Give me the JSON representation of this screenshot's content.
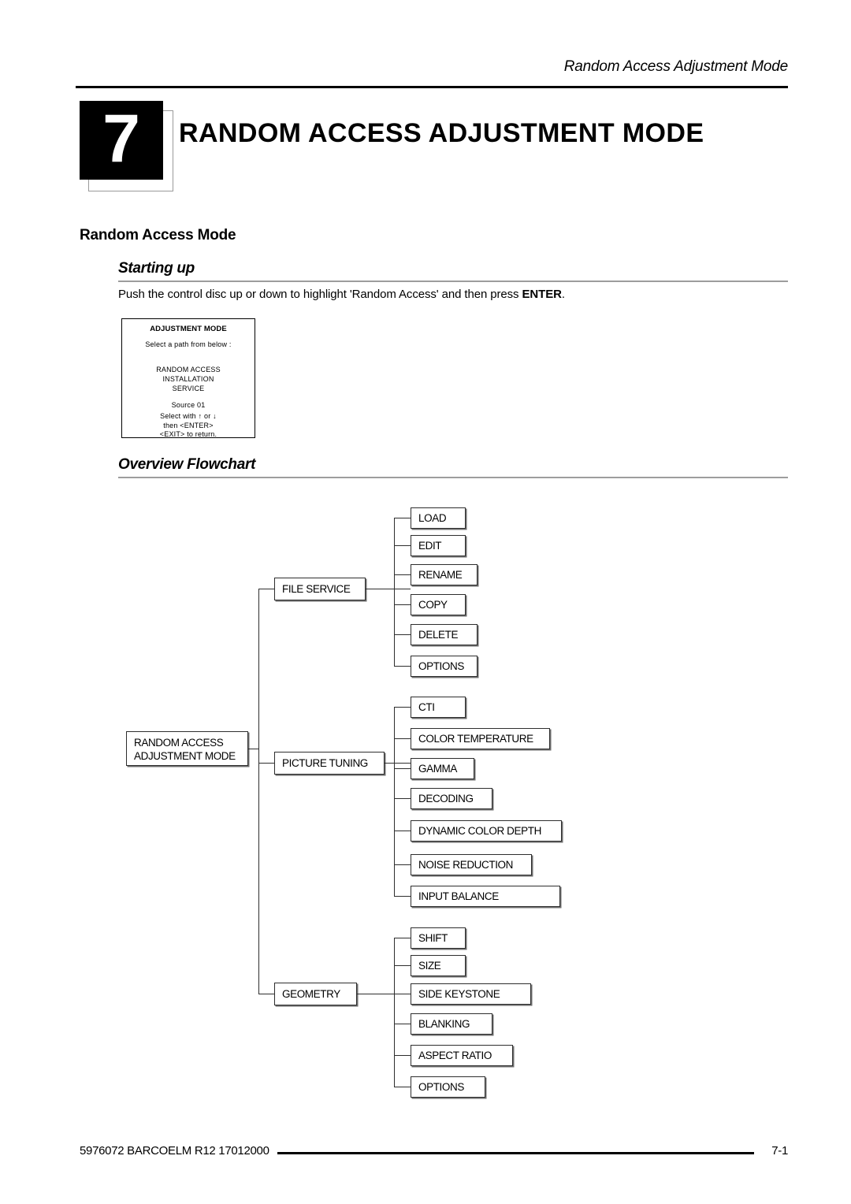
{
  "page": {
    "running_head": "Random Access Adjustment Mode",
    "chapter_number": "7",
    "chapter_title": "RANDOM ACCESS ADJUSTMENT MODE",
    "section_title": "Random Access Mode",
    "footer_left": "5976072 BARCOELM R12 17012000",
    "footer_page": "7-1"
  },
  "starting_up": {
    "heading": "Starting up",
    "instruction_pre": "Push the control disc up or down to highlight 'Random Access' and then press ",
    "instruction_bold": "ENTER",
    "instruction_post": "."
  },
  "osd_screen": {
    "title": "ADJUSTMENT MODE",
    "prompt": "Select a path from below :",
    "option_1": "RANDOM  ACCESS",
    "option_2": "INSTALLATION",
    "option_3": "SERVICE",
    "source": "Source  01",
    "hint_1": "Select with",
    "hint_up": "↑",
    "hint_or": "or",
    "hint_down": "↓",
    "hint_2": "then  <ENTER>",
    "hint_3": "<EXIT>  to  return."
  },
  "overview_flowchart": {
    "heading": "Overview Flowchart",
    "root": "RANDOM ACCESS\nADJUSTMENT MODE",
    "root_line1": "RANDOM ACCESS",
    "root_line2": "ADJUSTMENT MODE",
    "branches": [
      {
        "label": "FILE SERVICE",
        "children": [
          "LOAD",
          "EDIT",
          "RENAME",
          "COPY",
          "DELETE",
          "OPTIONS"
        ]
      },
      {
        "label": "PICTURE TUNING",
        "children": [
          "CTI",
          "COLOR TEMPERATURE",
          "GAMMA",
          "DECODING",
          "DYNAMIC COLOR DEPTH",
          "NOISE REDUCTION",
          "INPUT BALANCE"
        ]
      },
      {
        "label": "GEOMETRY",
        "children": [
          "SHIFT",
          "SIZE",
          "SIDE KEYSTONE",
          "BLANKING",
          "ASPECT RATIO",
          "OPTIONS"
        ]
      }
    ]
  }
}
